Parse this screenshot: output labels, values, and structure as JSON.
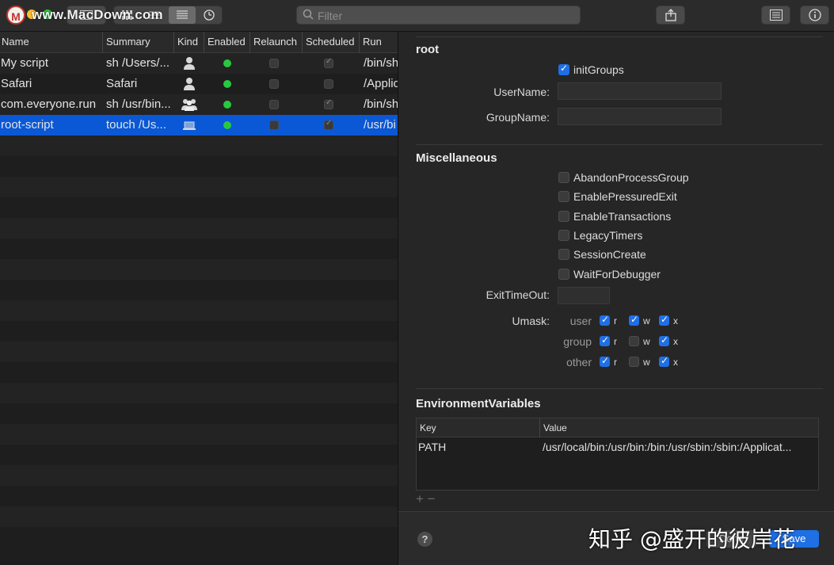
{
  "toolbar": {
    "logo_letter": "M",
    "watermark": "www.MacDown.com",
    "filter_placeholder": "Filter",
    "share_icon": "share-icon",
    "list_icon": "list-detail-icon",
    "info_icon": "info-icon"
  },
  "table": {
    "columns": [
      "Name",
      "Summary",
      "Kind",
      "Enabled",
      "Relaunch",
      "Scheduled",
      "Run"
    ],
    "rows": [
      {
        "name": "My script",
        "summary": "sh /Users/...",
        "kind": "user-icon",
        "enabled": true,
        "relaunch": false,
        "scheduled": true,
        "run": "/bin/sh"
      },
      {
        "name": "Safari",
        "summary": "Safari",
        "kind": "user-icon",
        "enabled": true,
        "relaunch": false,
        "scheduled": false,
        "run": "/Applic"
      },
      {
        "name": "com.everyone.run",
        "summary": "sh /usr/bin...",
        "kind": "group-icon",
        "enabled": true,
        "relaunch": false,
        "scheduled": true,
        "run": "/bin/sh"
      },
      {
        "name": "root-script",
        "summary": "touch /Us...",
        "kind": "computer-icon",
        "enabled": true,
        "relaunch": false,
        "scheduled": true,
        "run": "/usr/bi"
      }
    ]
  },
  "panel": {
    "root_title": "root",
    "init_groups_label": "initGroups",
    "username_label": "UserName:",
    "groupname_label": "GroupName:",
    "misc_title": "Miscellaneous",
    "misc_options": [
      {
        "label": "AbandonProcessGroup",
        "checked": false
      },
      {
        "label": "EnablePressuredExit",
        "checked": false
      },
      {
        "label": "EnableTransactions",
        "checked": false
      },
      {
        "label": "LegacyTimers",
        "checked": false
      },
      {
        "label": "SessionCreate",
        "checked": false
      },
      {
        "label": "WaitForDebugger",
        "checked": false
      }
    ],
    "exit_timeout_label": "ExitTimeOut:",
    "umask_label": "Umask:",
    "umask": [
      {
        "who": "user",
        "r": true,
        "w": true,
        "x": true
      },
      {
        "who": "group",
        "r": true,
        "w": false,
        "x": true
      },
      {
        "who": "other",
        "r": true,
        "w": false,
        "x": true
      }
    ],
    "umask_letters": [
      "r",
      "w",
      "x"
    ],
    "env_title": "EnvironmentVariables",
    "env_columns": [
      "Key",
      "Value"
    ],
    "env_rows": [
      {
        "key": "PATH",
        "value": "/usr/local/bin:/usr/bin:/bin:/usr/sbin:/sbin:/Applicat..."
      }
    ],
    "add_remove": "+ −",
    "help": "?",
    "done_label": "Done",
    "save_label": "Save",
    "watermark_zh": "知乎 @盛开的彼岸花"
  },
  "colors": {
    "accent": "#1f6fe5",
    "selection": "#0a58d6",
    "enabled_dot": "#27c93f"
  }
}
